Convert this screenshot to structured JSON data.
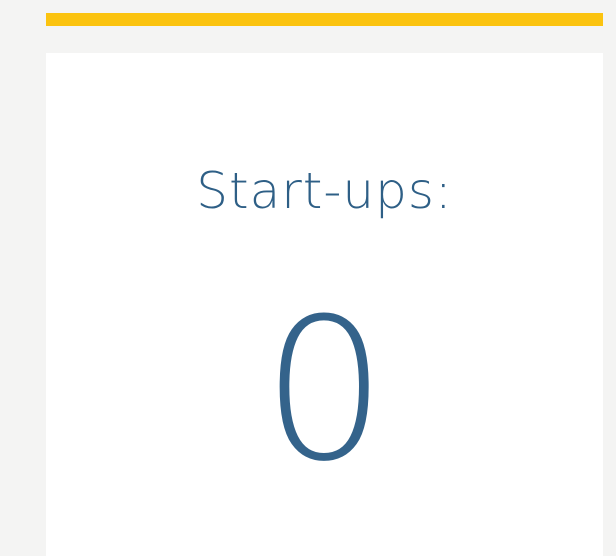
{
  "colors": {
    "accent": "#fbc30f",
    "text": "#2e5f86",
    "page_background": "#f4f4f3",
    "card_background": "#ffffff"
  },
  "stat": {
    "label": "Start-ups:",
    "value": "0"
  }
}
